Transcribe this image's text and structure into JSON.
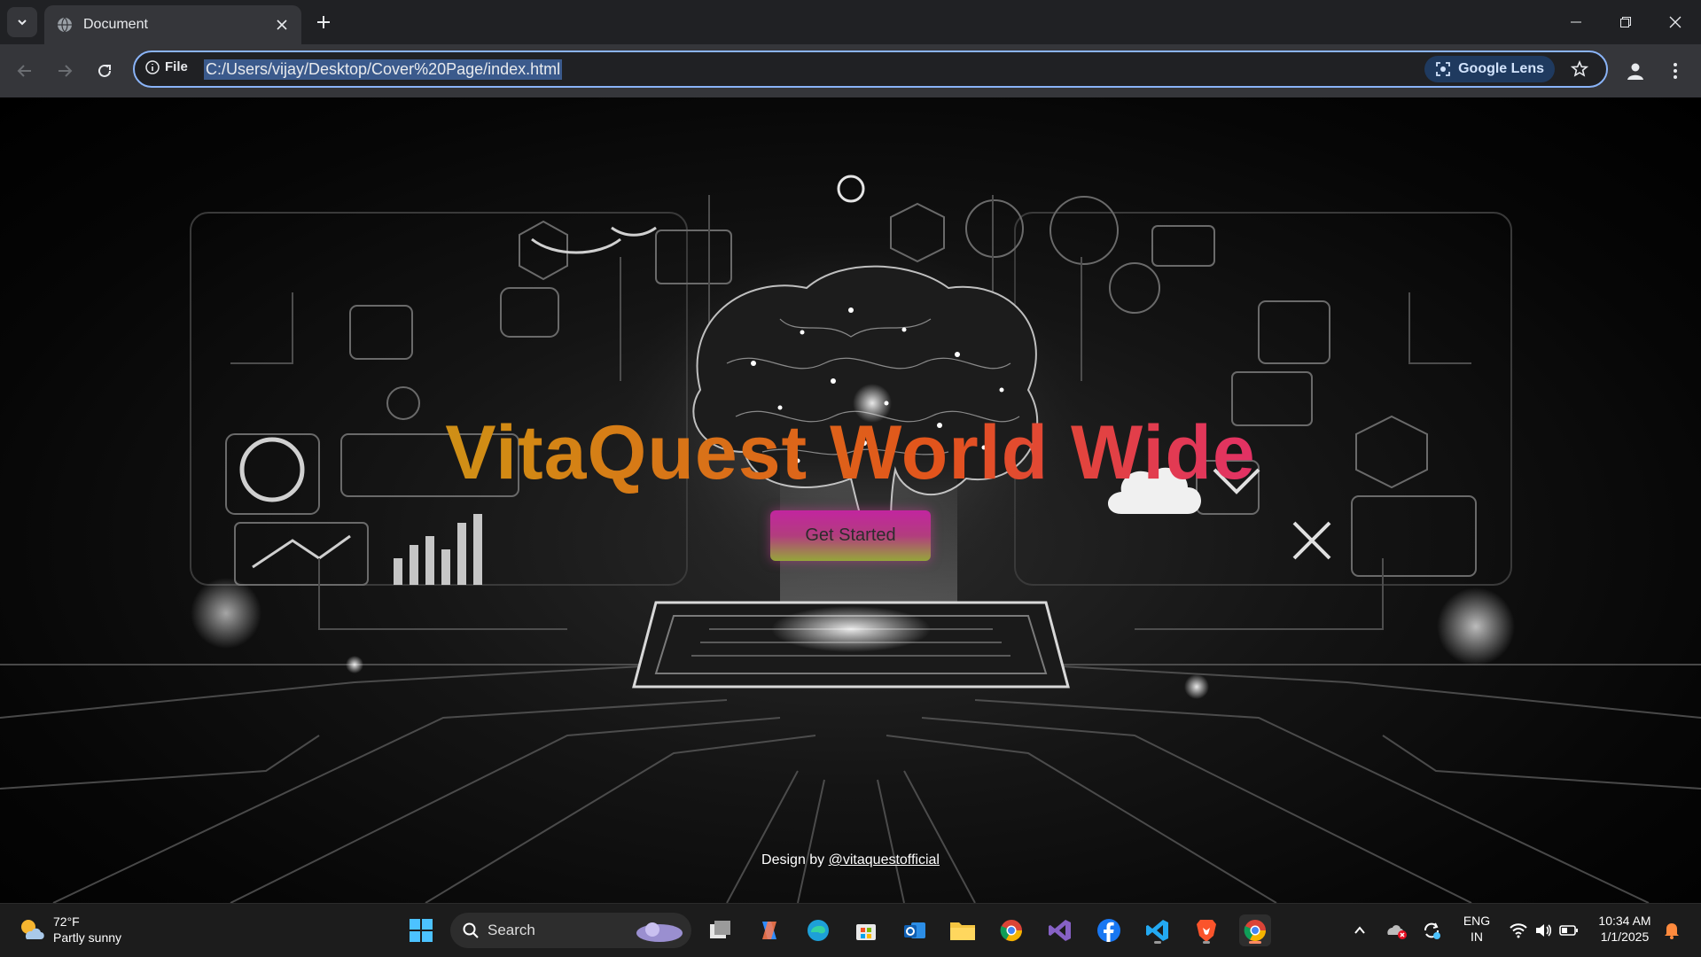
{
  "browser": {
    "tab_title": "Document",
    "omnibox": {
      "scheme_label": "File",
      "url": "C:/Users/vijay/Desktop/Cover%20Page/index.html",
      "lens_label": "Google Lens"
    }
  },
  "page": {
    "hero_title": "VitaQuest World Wide",
    "cta_label": "Get Started",
    "credit_prefix": "Design by ",
    "credit_handle": "@vitaquestofficial",
    "colors": {
      "title_gradient": [
        "#b7b32b",
        "#d28a14",
        "#e2541c",
        "#e22f6a",
        "#c21fa5"
      ],
      "cta_top": "#c2259f",
      "cta_bottom": "#96a63a"
    }
  },
  "taskbar": {
    "weather": {
      "temp": "72°F",
      "condition": "Partly sunny"
    },
    "search_label": "Search",
    "pinned_apps": [
      "task-view",
      "copilot",
      "edge",
      "store",
      "outlook",
      "file-explorer",
      "chrome",
      "visual-studio",
      "facebook",
      "vscode",
      "brave",
      "chrome-active"
    ],
    "tray": {
      "lang_top": "ENG",
      "lang_bottom": "IN",
      "time": "10:34 AM",
      "date": "1/1/2025"
    }
  }
}
